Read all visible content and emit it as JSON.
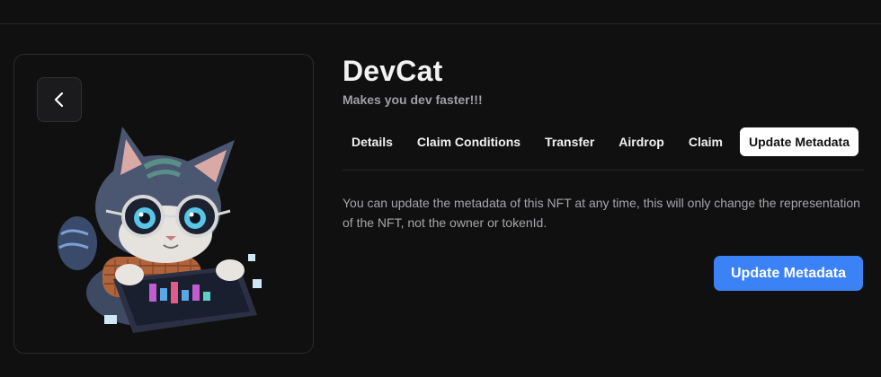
{
  "nft": {
    "name": "DevCat",
    "description": "Makes you dev faster!!!"
  },
  "tabs": [
    {
      "label": "Details",
      "active": false
    },
    {
      "label": "Claim Conditions",
      "active": false
    },
    {
      "label": "Transfer",
      "active": false
    },
    {
      "label": "Airdrop",
      "active": false
    },
    {
      "label": "Claim",
      "active": false
    },
    {
      "label": "Update Metadata",
      "active": true
    }
  ],
  "update_panel": {
    "body": "You can update the metadata of this NFT at any time, this will only change the representation of the NFT, not the owner or tokenId.",
    "button_label": "Update Metadata"
  },
  "icons": {
    "back": "chevron-left-icon"
  },
  "colors": {
    "accent": "#3b82f6",
    "background": "#101011"
  }
}
